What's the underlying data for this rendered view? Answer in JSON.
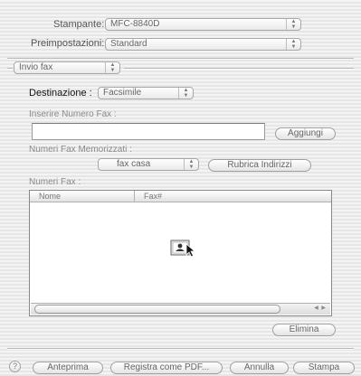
{
  "printer": {
    "label": "Stampante:",
    "value": "MFC-8840D"
  },
  "presets": {
    "label": "Preimpostazioni:",
    "value": "Standard"
  },
  "panel_select": {
    "value": "Invio fax"
  },
  "destination": {
    "label": "Destinazione :",
    "value": "Facsimile"
  },
  "fax_number_input": {
    "label": "Inserire Numero Fax :",
    "value": "",
    "add_button": "Aggiungi"
  },
  "stored_numbers": {
    "label": "Numeri Fax Memorizzati :",
    "value": "fax casa",
    "address_book_button": "Rubrica Indirizzi"
  },
  "fax_numbers_list": {
    "label": "Numeri Fax :",
    "columns": [
      "Nome",
      "Fax#"
    ],
    "rows": []
  },
  "delete_button": "Elimina",
  "footer": {
    "help": "?",
    "preview": "Anteprima",
    "save_pdf": "Registra come PDF...",
    "cancel": "Annulla",
    "print": "Stampa"
  },
  "icons": [
    "popup-arrows-icon",
    "drag-address-card-icon",
    "mouse-pointer-icon",
    "help-icon"
  ]
}
